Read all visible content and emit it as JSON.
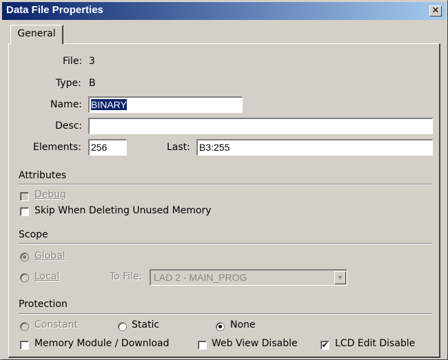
{
  "window": {
    "title": "Data File Properties",
    "close_glyph": "✕"
  },
  "tabs": [
    {
      "label": "General"
    }
  ],
  "fields": {
    "file": {
      "label": "File:",
      "value": "3"
    },
    "type": {
      "label": "Type:",
      "value": "B"
    },
    "name": {
      "label": "Name:",
      "value": "BINARY"
    },
    "desc": {
      "label": "Desc:",
      "value": ""
    },
    "elements": {
      "label": "Elements:",
      "value": "256"
    },
    "last": {
      "label": "Last:",
      "value": "B3:255"
    }
  },
  "attributes": {
    "heading": "Attributes",
    "debug": {
      "label": "Debug",
      "checked": false,
      "enabled": false
    },
    "skip_unused": {
      "label": "Skip When Deleting Unused Memory",
      "checked": false,
      "enabled": true
    }
  },
  "scope": {
    "heading": "Scope",
    "global": {
      "label": "Global",
      "selected": true,
      "enabled": false
    },
    "local": {
      "label": "Local",
      "selected": false,
      "enabled": false
    },
    "to_file": {
      "label": "To File:",
      "value": "LAD 2 - MAIN_PROG"
    }
  },
  "protection": {
    "heading": "Protection",
    "constant": {
      "label": "Constant",
      "selected": false,
      "enabled": false
    },
    "static": {
      "label": "Static",
      "selected": false,
      "enabled": true
    },
    "none": {
      "label": "None",
      "selected": true,
      "enabled": true
    },
    "memory_module": {
      "label": "Memory Module / Download",
      "checked": false
    },
    "web_view_disable": {
      "label": "Web View Disable",
      "checked": false
    },
    "lcd_edit_disable": {
      "label": "LCD Edit Disable",
      "checked": true
    }
  },
  "icons": {
    "check": "✔",
    "dropdown": "▼"
  }
}
